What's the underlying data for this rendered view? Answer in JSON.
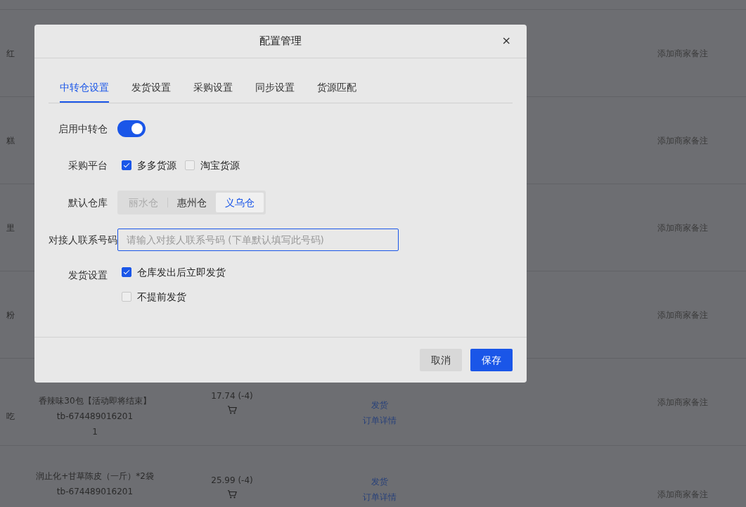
{
  "background_table": {
    "rows": [
      {
        "column_1": "红",
        "remark_link": "添加商家备注"
      },
      {
        "column_1": "糕",
        "remark_link": "添加商家备注"
      },
      {
        "column_1": "里",
        "remark_link": "添加商家备注"
      },
      {
        "column_1": "粉",
        "remark_link": "添加商家备注"
      },
      {
        "column_1": "吃",
        "product": [
          "香辣味30包【活动即将结束】",
          "tb-674489016201",
          "1"
        ],
        "price": "17.74 (-4)",
        "actions": [
          "发货",
          "订单详情"
        ],
        "remark_link": "添加商家备注"
      },
      {
        "product": [
          "润止化+甘草陈皮（一斤）*2袋",
          "tb-674489016201"
        ],
        "price": "25.99 (-4)",
        "actions": [
          "发货",
          "订单详情"
        ],
        "remark_link": "添加商家备注"
      }
    ]
  },
  "dialog": {
    "title": "配置管理",
    "close": "×",
    "tabs": [
      {
        "label": "中转仓设置",
        "selected": true
      },
      {
        "label": "发货设置",
        "selected": false
      },
      {
        "label": "采购设置",
        "selected": false
      },
      {
        "label": "同步设置",
        "selected": false
      },
      {
        "label": "货源匹配",
        "selected": false
      }
    ],
    "form": [
      {
        "kind": "switch",
        "label": "启用中转仓",
        "on": true
      },
      {
        "kind": "checkboxes",
        "label": "采购平台",
        "inline": true,
        "options": [
          {
            "label": "多多货源",
            "checked": true
          },
          {
            "label": "淘宝货源",
            "checked": false
          }
        ]
      },
      {
        "kind": "segmented",
        "label": "默认仓库",
        "options": [
          {
            "label": "丽水仓",
            "selected": false,
            "disabled": true
          },
          {
            "label": "惠州仓",
            "selected": false,
            "disabled": false
          },
          {
            "label": "义乌仓",
            "selected": true,
            "disabled": false
          }
        ]
      },
      {
        "kind": "input",
        "label": "对接人联系号码",
        "placeholder": "请输入对接人联系号码 (下单默认填写此号码)"
      },
      {
        "kind": "checkboxes",
        "label": "发货设置",
        "inline": false,
        "options": [
          {
            "label": "仓库发出后立即发货",
            "checked": true
          },
          {
            "label": "不提前发货",
            "checked": false
          }
        ]
      }
    ],
    "buttons": [
      {
        "label": "取消",
        "kind": "secondary"
      },
      {
        "label": "保存",
        "kind": "primary"
      }
    ]
  }
}
